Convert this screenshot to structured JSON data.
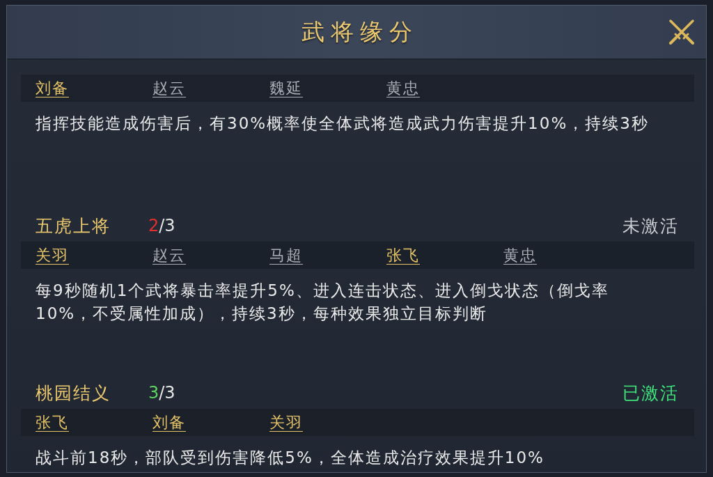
{
  "window": {
    "title": "武将缘分"
  },
  "bonds": [
    {
      "heroes": [
        {
          "name": "刘备",
          "owned": true
        },
        {
          "name": "赵云",
          "owned": false
        },
        {
          "name": "魏延",
          "owned": false
        },
        {
          "name": "黄忠",
          "owned": false
        }
      ],
      "description": "指挥技能造成伤害后，有30%概率使全体武将造成武力伤害提升10%，持续3秒"
    },
    {
      "name": "五虎上将",
      "progress": {
        "current": "2",
        "total": "/3"
      },
      "status": "未激活",
      "active": false,
      "heroes": [
        {
          "name": "关羽",
          "owned": true
        },
        {
          "name": "赵云",
          "owned": false
        },
        {
          "name": "马超",
          "owned": false
        },
        {
          "name": "张飞",
          "owned": true
        },
        {
          "name": "黄忠",
          "owned": false
        }
      ],
      "description": "每9秒随机1个武将暴击率提升5%、进入连击状态、进入倒戈状态（倒戈率10%，不受属性加成），持续3秒，每种效果独立目标判断"
    },
    {
      "name": "桃园结义",
      "progress": {
        "current": "3",
        "total": "/3"
      },
      "status": "已激活",
      "active": true,
      "heroes": [
        {
          "name": "张飞",
          "owned": true
        },
        {
          "name": "刘备",
          "owned": true
        },
        {
          "name": "关羽",
          "owned": true
        }
      ],
      "description": "战斗前18秒，部队受到伤害降低5%，全体造成治疗效果提升10%"
    }
  ]
}
